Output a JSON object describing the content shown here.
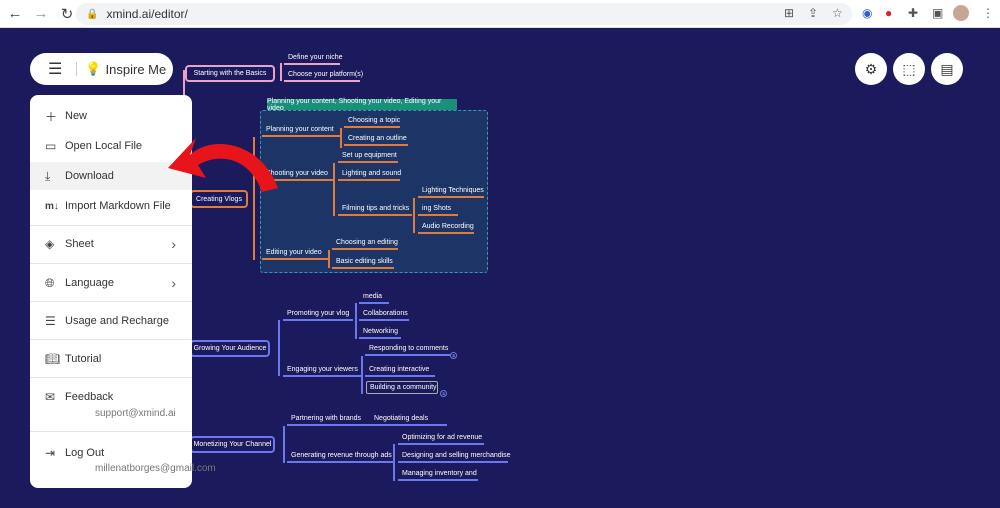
{
  "browser": {
    "url": "xmind.ai/editor/"
  },
  "toolbar": {
    "inspire_label": "Inspire Me"
  },
  "menu": {
    "new": "New",
    "open_local": "Open Local File",
    "download": "Download",
    "import_md": "Import Markdown File",
    "sheet": "Sheet",
    "language": "Language",
    "usage": "Usage and Recharge",
    "tutorial": "Tutorial",
    "feedback": "Feedback",
    "feedback_email": "support@xmind.ai",
    "logout": "Log Out",
    "user_email": "millenatborges@gmail.com"
  },
  "map": {
    "basics": {
      "title": "Starting with the Basics",
      "children": [
        "Define your niche",
        "Choose your platform(s)"
      ]
    },
    "vlogs": {
      "title": "Creating Vlogs",
      "summary": "Planning your content, Shooting your video, Editing your video",
      "planning": "Planning your content",
      "planning_children": [
        "Choosing a topic",
        "Creating an outline"
      ],
      "shooting": "Shooting your video",
      "shooting_children": [
        "Set up equipment",
        "Lighting and sound",
        "Filming tips and tricks"
      ],
      "filming_children": [
        "Lighting Techniques",
        "ing Shots",
        "Audio Recording"
      ],
      "editing": "Editing your video",
      "editing_children": [
        "Choosing an editing",
        "Basic editing skills"
      ]
    },
    "audience": {
      "title": "Growing Your Audience",
      "promoting": "Promoting your vlog",
      "promoting_children": [
        "media",
        "Collaborations",
        "Networking"
      ],
      "engaging": "Engaging your viewers",
      "engaging_children": [
        "Responding to comments",
        "Creating interactive",
        "Building a community"
      ],
      "badge": "3"
    },
    "monetizing": {
      "title": "Monetizing Your Channel",
      "partnering": "Partnering with brands",
      "partnering_child": "Negotiating deals",
      "generating": "Generating revenue through ads",
      "generating_children": [
        "Optimizing for ad revenue",
        "Designing and selling merchandise",
        "Managing inventory and"
      ]
    }
  },
  "colors": {
    "canvas": "#1b1a5c",
    "orange": "#e07b39",
    "blue": "#6a78f0",
    "pink": "#e6a4c8",
    "summary": "#1a8f7a",
    "arrow": "#e8141b"
  }
}
